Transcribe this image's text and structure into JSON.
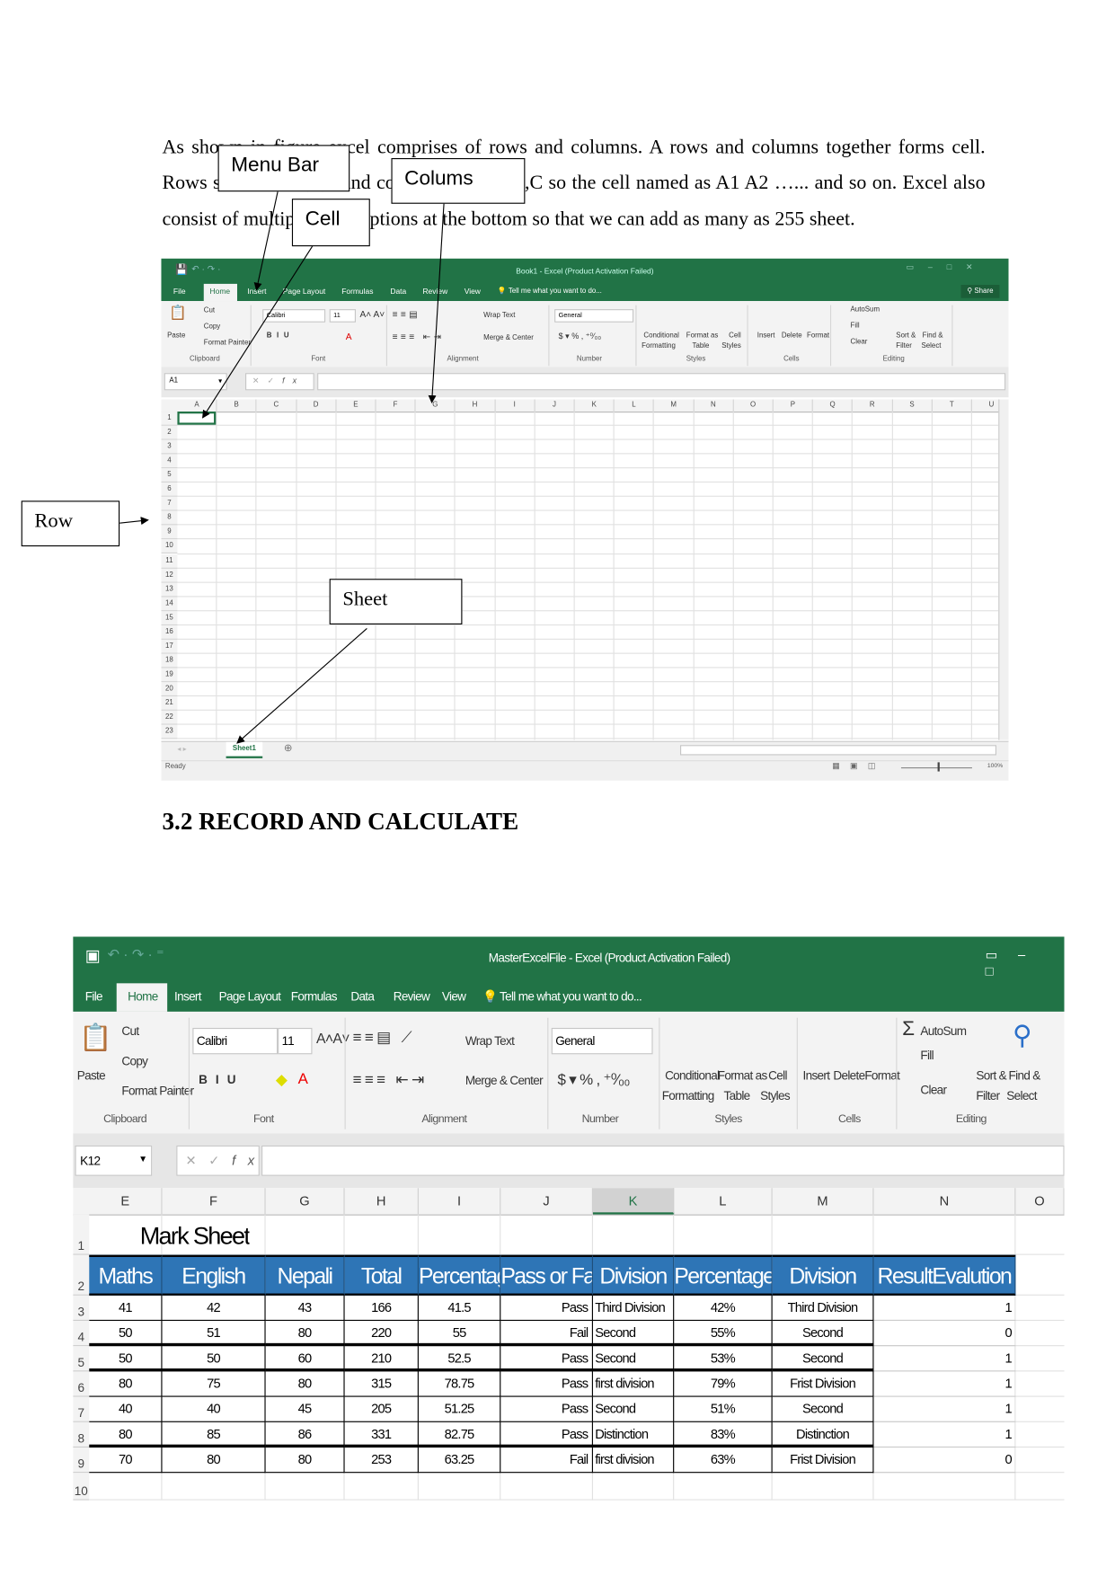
{
  "paragraph": {
    "line1": "As shown in figure excel comprises of rows and columns. A rows and columns together forms cell.",
    "line2": "Rows start from 1,2,3 and columns from A,B,C so the cell named as A1 A2 …... and so on. Excel also",
    "line3": "consist of multiple sheet options at the bottom so that we can add as many as 255 sheet."
  },
  "callouts": {
    "menu_bar": "Menu Bar",
    "columns": "Colums",
    "cell": "Cell",
    "row": "Row",
    "sheet": "Sheet"
  },
  "section_heading": "3.2 RECORD AND CALCULATE",
  "colors": {
    "excel_green": "#217346",
    "header_blue": "#2e75b6"
  },
  "excel1": {
    "title": "Book1 - Excel (Product Activation Failed)",
    "share": "Share",
    "tabs": [
      "File",
      "Home",
      "Insert",
      "Page Layout",
      "Formulas",
      "Data",
      "Review",
      "View"
    ],
    "tell_me": "Tell me what you want to do...",
    "ribbon": {
      "paste": "Paste",
      "cut": "Cut",
      "copy": "Copy",
      "format_painter": "Format Painter",
      "font_name": "Calibri",
      "font_size": "11",
      "wrap_text": "Wrap Text",
      "merge_center": "Merge & Center",
      "number_format": "General",
      "conditional": "Conditional",
      "formatting": "Formatting",
      "format_as": "Format as",
      "table": "Table",
      "cell": "Cell",
      "styles_btn": "Styles",
      "insert": "Insert",
      "delete": "Delete",
      "format": "Format",
      "autosum": "AutoSum",
      "fill": "Fill",
      "clear": "Clear",
      "sort": "Sort &",
      "filter": "Filter",
      "find": "Find &",
      "select": "Select",
      "groups": [
        "Clipboard",
        "Font",
        "Alignment",
        "Number",
        "Styles",
        "Cells",
        "Editing"
      ]
    },
    "name_box": "A1",
    "columns": [
      "A",
      "B",
      "C",
      "D",
      "E",
      "F",
      "G",
      "H",
      "I",
      "J",
      "K",
      "L",
      "M",
      "N",
      "O",
      "P",
      "Q",
      "R",
      "S",
      "T",
      "U"
    ],
    "rows": [
      "1",
      "2",
      "3",
      "4",
      "5",
      "6",
      "7",
      "8",
      "9",
      "10",
      "11",
      "12",
      "13",
      "14",
      "15",
      "16",
      "17",
      "18",
      "19",
      "20",
      "21",
      "22",
      "23"
    ],
    "sheet_tab": "Sheet1",
    "status": "Ready",
    "zoom": "100%"
  },
  "excel2": {
    "title": "MasterExcelFile - Excel (Product Activation Failed)",
    "tabs": [
      "File",
      "Home",
      "Insert",
      "Page Layout",
      "Formulas",
      "Data",
      "Review",
      "View"
    ],
    "tell_me": "Tell me what you want to do...",
    "ribbon": {
      "paste": "Paste",
      "cut": "Cut",
      "copy": "Copy",
      "format_painter": "Format Painter",
      "font_name": "Calibri",
      "font_size": "11",
      "wrap_text": "Wrap Text",
      "merge_center": "Merge & Center",
      "number_format": "General",
      "conditional": "Conditional",
      "formatting": "Formatting",
      "format_as": "Format as",
      "table": "Table",
      "cell": "Cell",
      "styles_btn": "Styles",
      "insert": "Insert",
      "delete": "Delete",
      "format": "Format",
      "autosum": "AutoSum",
      "fill": "Fill",
      "clear": "Clear",
      "sort": "Sort &",
      "filter": "Filter",
      "find": "Find &",
      "select": "Select",
      "groups": [
        "Clipboard",
        "Font",
        "Alignment",
        "Number",
        "Styles",
        "Cells",
        "Editing"
      ]
    },
    "name_box": "K12",
    "columns": [
      "E",
      "F",
      "G",
      "H",
      "I",
      "J",
      "K",
      "L",
      "M",
      "N",
      "O"
    ],
    "selected_column": "K",
    "rows": [
      "1",
      "2",
      "3",
      "4",
      "5",
      "6",
      "7",
      "8",
      "9",
      "10"
    ],
    "sheet_title": "Mark Sheet",
    "headers": [
      "Maths",
      "English",
      "Nepali",
      "Total",
      "Percentage",
      "Pass or Fail",
      "Division",
      "Percentage",
      "Division",
      "ResultEvalution"
    ],
    "data": [
      [
        "41",
        "42",
        "43",
        "166",
        "41.5",
        "Pass",
        "Third Division",
        "42%",
        "Third Division",
        "1"
      ],
      [
        "50",
        "51",
        "80",
        "220",
        "55",
        "Fail",
        "Second",
        "55%",
        "Second",
        "0"
      ],
      [
        "50",
        "50",
        "60",
        "210",
        "52.5",
        "Pass",
        "Second",
        "53%",
        "Second",
        "1"
      ],
      [
        "80",
        "75",
        "80",
        "315",
        "78.75",
        "Pass",
        "first division",
        "79%",
        "Frist Division",
        "1"
      ],
      [
        "40",
        "40",
        "45",
        "205",
        "51.25",
        "Pass",
        "Second",
        "51%",
        "Second",
        "1"
      ],
      [
        "80",
        "85",
        "86",
        "331",
        "82.75",
        "Pass",
        "Distinction",
        "83%",
        "Distinction",
        "1"
      ],
      [
        "70",
        "80",
        "80",
        "253",
        "63.25",
        "Fail",
        "first division",
        "63%",
        "Frist Division",
        "0"
      ]
    ]
  }
}
